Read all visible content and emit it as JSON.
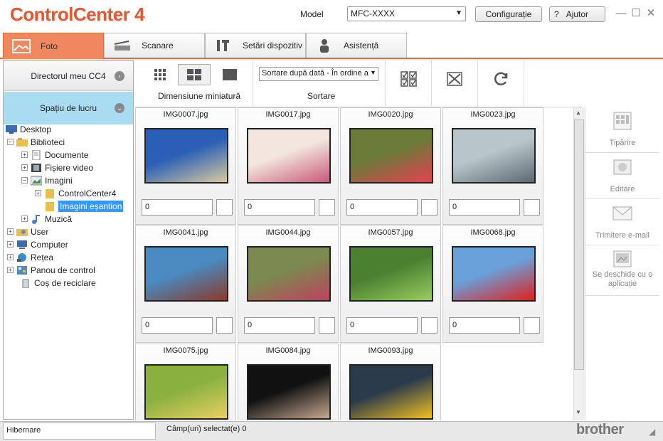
{
  "app": {
    "title": "ControlCenter 4"
  },
  "header": {
    "model_label": "Model",
    "model_value": "MFC-XXXX",
    "config_label": "Configurație",
    "help_label": "Ajutor",
    "help_icon": "?"
  },
  "tabs": [
    {
      "label": "Foto",
      "icon": "photo-icon"
    },
    {
      "label": "Scanare",
      "icon": "scanner-icon"
    },
    {
      "label": "Setări dispozitiv",
      "icon": "tools-icon"
    },
    {
      "label": "Asistență",
      "icon": "person-icon"
    }
  ],
  "left": {
    "dir_label": "Directorul meu CC4",
    "workspace_label": "Spațiu de lucru",
    "tree": [
      {
        "label": "Desktop"
      },
      {
        "label": "Biblioteci"
      },
      {
        "label": "Documente"
      },
      {
        "label": "Fișiere video"
      },
      {
        "label": "Imagini"
      },
      {
        "label": "ControlCenter4"
      },
      {
        "label": "Imagini eșantion"
      },
      {
        "label": "Muzică"
      },
      {
        "label": "User"
      },
      {
        "label": "Computer"
      },
      {
        "label": "Rețea"
      },
      {
        "label": "Panou de control"
      },
      {
        "label": "Coș de reciclare"
      }
    ]
  },
  "toolbar": {
    "thumb_size_label": "Dimensiune miniatură",
    "sort_label": "Sortare",
    "sort_value": "Sortare după dată - În ordine a"
  },
  "thumbnails": [
    {
      "name": "IMG0007.jpg",
      "qty": "0",
      "colors": [
        "#2a5fb5",
        "#d8c9a0"
      ]
    },
    {
      "name": "IMG0017.jpg",
      "qty": "0",
      "colors": [
        "#f3e6de",
        "#c85a7a"
      ]
    },
    {
      "name": "IMG0020.jpg",
      "qty": "0",
      "colors": [
        "#6c7a3a",
        "#e64050"
      ]
    },
    {
      "name": "IMG0023.jpg",
      "qty": "0",
      "colors": [
        "#b8c6cc",
        "#5a6a70"
      ]
    },
    {
      "name": "IMG0041.jpg",
      "qty": "0",
      "colors": [
        "#4a8ac0",
        "#8a3a2a"
      ]
    },
    {
      "name": "IMG0044.jpg",
      "qty": "0",
      "colors": [
        "#7a8a50",
        "#c04060"
      ]
    },
    {
      "name": "IMG0057.jpg",
      "qty": "0",
      "colors": [
        "#4a8030",
        "#9acc60"
      ]
    },
    {
      "name": "IMG0068.jpg",
      "qty": "0",
      "colors": [
        "#6aa0d8",
        "#e02020"
      ]
    },
    {
      "name": "IMG0075.jpg",
      "qty": "0",
      "colors": [
        "#8ab040",
        "#e8d060"
      ]
    },
    {
      "name": "IMG0084.jpg",
      "qty": "0",
      "colors": [
        "#111111",
        "#c8a890"
      ]
    },
    {
      "name": "IMG0093.jpg",
      "qty": "0",
      "colors": [
        "#2a3a4a",
        "#f0c020"
      ]
    }
  ],
  "right": {
    "print": "Tipărire",
    "edit": "Editare",
    "email": "Trimitere e-mail",
    "open_with": "Se deschide cu o aplicație"
  },
  "status": {
    "mode": "Hibernare",
    "selected": "Câmp(uri) selectat(e) 0",
    "brand": "brother"
  }
}
